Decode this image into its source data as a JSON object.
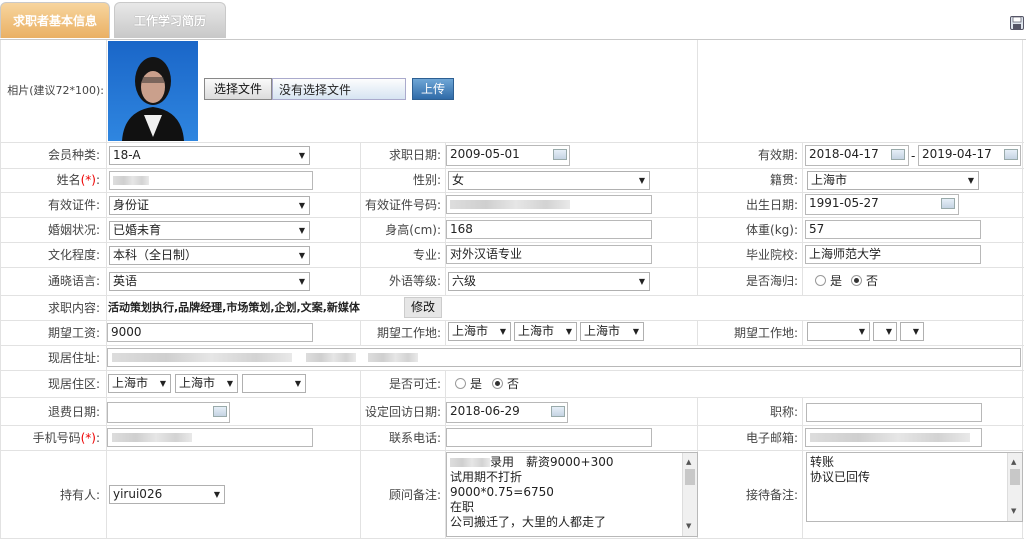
{
  "tabs": [
    {
      "label": "求职者基本信息"
    },
    {
      "label": "工作学习简历"
    }
  ],
  "photo": {
    "label": "相片(建议72*100):",
    "choose_button": "选择文件",
    "no_file_text": "没有选择文件",
    "upload_button": "上传"
  },
  "fields": {
    "member_type": {
      "label": "会员种类:",
      "value": "18-A"
    },
    "apply_date": {
      "label": "求职日期:",
      "value": "2009-05-01"
    },
    "valid_period": {
      "label": "有效期:",
      "from": "2018-04-17",
      "sep": "-",
      "to": "2019-04-17"
    },
    "name": {
      "label": "姓名",
      "req": "(*)",
      "colon": ":"
    },
    "gender": {
      "label": "性别:",
      "value": "女"
    },
    "native_place": {
      "label": "籍贯:",
      "value": "上海市"
    },
    "id_type": {
      "label": "有效证件:",
      "value": "身份证"
    },
    "id_number": {
      "label": "有效证件号码:"
    },
    "birth_date": {
      "label": "出生日期:",
      "value": "1991-05-27"
    },
    "marital": {
      "label": "婚姻状况:",
      "value": "已婚未育"
    },
    "height": {
      "label": "身高(cm):",
      "value": "168"
    },
    "weight": {
      "label": "体重(kg):",
      "value": "57"
    },
    "education": {
      "label": "文化程度:",
      "value": "本科（全日制）"
    },
    "major": {
      "label": "专业:",
      "value": "对外汉语专业"
    },
    "school": {
      "label": "毕业院校:",
      "value": "上海师范大学"
    },
    "language": {
      "label": "通晓语言:",
      "value": "英语"
    },
    "foreign_level": {
      "label": "外语等级:",
      "value": "六级"
    },
    "returnee": {
      "label": "是否海归:",
      "yes": "是",
      "no": "否"
    },
    "job_content": {
      "label": "求职内容:",
      "value": "活动策划执行,品牌经理,市场策划,企划,文案,新媒体",
      "edit_button": "修改"
    },
    "expected_salary": {
      "label": "期望工资:",
      "value": "9000"
    },
    "expected_location": {
      "label": "期望工作地:",
      "p1": "上海市",
      "p2": "上海市",
      "p3": "上海市"
    },
    "expected_location2": {
      "label": "期望工作地:"
    },
    "address": {
      "label": "现居住址:"
    },
    "district": {
      "label": "现居住区:",
      "p1": "上海市",
      "p2": "上海市"
    },
    "relocate": {
      "label": "是否可迁:",
      "yes": "是",
      "no": "否"
    },
    "refund_date": {
      "label": "退费日期:"
    },
    "revisit_date": {
      "label": "设定回访日期:",
      "value": "2018-06-29"
    },
    "job_title": {
      "label": "职称:"
    },
    "mobile": {
      "label": "手机号码",
      "req": "(*)",
      "colon": ":"
    },
    "phone": {
      "label": "联系电话:"
    },
    "email": {
      "label": "电子邮箱:"
    },
    "holder": {
      "label": "持有人:",
      "value": "yirui026"
    },
    "consultant_notes": {
      "label": "顾问备注:",
      "lines": [
        "录用　薪资9000+300",
        "试用期不打折",
        "9000*0.75=6750",
        "在职",
        "公司搬迁了，大里的人都走了"
      ]
    },
    "reception_notes": {
      "label": "接待备注:",
      "lines": [
        "转账",
        "协议已回传"
      ]
    }
  }
}
